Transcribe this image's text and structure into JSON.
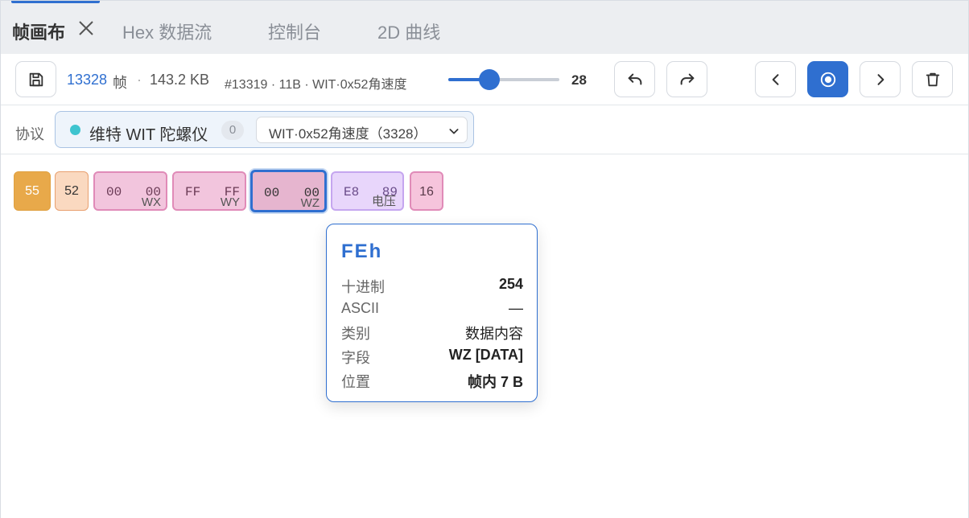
{
  "tabs": [
    {
      "label": "帧画布",
      "active": true
    },
    {
      "label": "Hex 数据流",
      "active": false
    },
    {
      "label": "控制台",
      "active": false
    },
    {
      "label": "2D 曲线",
      "active": false
    }
  ],
  "toolbar": {
    "frame_count": "13328",
    "frame_unit": "帧",
    "separator": "·",
    "size": "143.2 KB",
    "frame_info": "#13319 · 11B · WIT·0x52角速度",
    "slider_value": "28",
    "slider_fraction": 0.37
  },
  "protocol": {
    "label": "协议",
    "name": "维特 WIT 陀螺仪",
    "count": "0",
    "selected_frame_type": "WIT·0x52角速度（3328）"
  },
  "bytes": [
    {
      "kind": "header1",
      "text": "55"
    },
    {
      "kind": "header2",
      "text": "52"
    },
    {
      "kind": "data",
      "b1": "00",
      "b2": "00",
      "field": "WX"
    },
    {
      "kind": "data",
      "b1": "FF",
      "b2": "FF",
      "field": "WY"
    },
    {
      "kind": "selected",
      "b1": "00",
      "b2": "00",
      "field": "WZ"
    },
    {
      "kind": "volt",
      "b1": "E8",
      "b2": "89",
      "field": "电压"
    },
    {
      "kind": "check",
      "text": "16"
    }
  ],
  "tooltip": {
    "title": "FEh",
    "rows": [
      {
        "key": "十进制",
        "value": "254"
      },
      {
        "key": "ASCII",
        "value": "—"
      },
      {
        "key": "类别",
        "value": "数据内容"
      },
      {
        "key": "字段",
        "value": "WZ [DATA]"
      },
      {
        "key": "位置",
        "value": "帧内 7 B"
      }
    ]
  },
  "colors": {
    "accent": "#2f6fd0",
    "header_byte": "#e8a94a",
    "data_byte": "#f2c5dd",
    "voltage_byte": "#e8d6fb",
    "protocol_dot": "#3ec4cf"
  }
}
